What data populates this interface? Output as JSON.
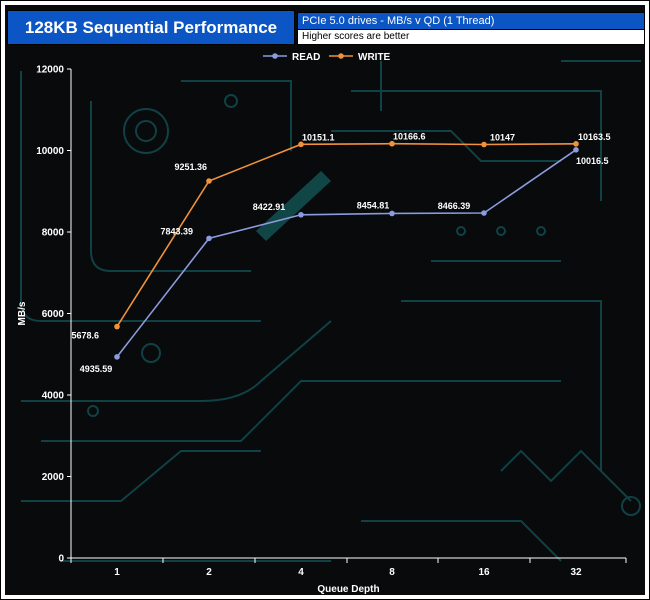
{
  "header": {
    "title": "128KB Sequential Performance",
    "subtitle_line1": "PCIe 5.0 drives - MB/s v QD (1 Thread)",
    "subtitle_line2": "Higher scores are better"
  },
  "colors": {
    "title_bg": "#0b55c4",
    "plot_bg": "#080a0c",
    "read": "#8b9bde",
    "write": "#f0923a",
    "decoration": "#0f4145"
  },
  "chart_data": {
    "type": "line",
    "title": "128KB Sequential Performance",
    "xlabel": "Queue Depth",
    "ylabel": "MB/s",
    "categories": [
      "1",
      "2",
      "4",
      "8",
      "16",
      "32"
    ],
    "ylim": [
      0,
      12000
    ],
    "yticks": [
      0,
      2000,
      4000,
      6000,
      8000,
      10000,
      12000
    ],
    "legend_position": "top-center",
    "grid": false,
    "series": [
      {
        "name": "READ",
        "color": "#8b9bde",
        "values": [
          4935.59,
          7843.39,
          8422.91,
          8454.81,
          8466.39,
          10016.5
        ],
        "labels": [
          "4935.59",
          "7843.39",
          "8422.91",
          "8454.81",
          "8466.39",
          "10016.5"
        ]
      },
      {
        "name": "WRITE",
        "color": "#f0923a",
        "values": [
          5678.6,
          9251.36,
          10151.1,
          10166.6,
          10147,
          10163.5
        ],
        "labels": [
          "5678.6",
          "9251.36",
          "10151.1",
          "10166.6",
          "10147",
          "10163.5"
        ]
      }
    ]
  }
}
